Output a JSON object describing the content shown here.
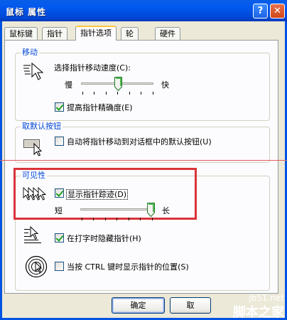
{
  "window": {
    "title": "鼠标 属性",
    "help_label": "?",
    "close_label": "✕"
  },
  "tabs": [
    {
      "label": "鼠标键"
    },
    {
      "label": "指针"
    },
    {
      "label": "指针选项",
      "active": true
    },
    {
      "label": "轮"
    },
    {
      "label": "硬件"
    }
  ],
  "motion": {
    "legend": "移动",
    "speed_label": "选择指针移动速度(C):",
    "slow_label": "慢",
    "fast_label": "快",
    "speed_value_fraction": 0.5,
    "precision_label": "提高指针精确度(E)",
    "precision_checked": true
  },
  "snap_to": {
    "legend": "取默认按钮",
    "snap_label": "自动将指针移动到对话框中的默认按钮(U)",
    "snap_checked": false
  },
  "visibility": {
    "legend": "可见性",
    "trails_label": "显示指针踪迹(D)",
    "trails_checked": true,
    "short_label": "短",
    "long_label": "长",
    "trail_length_fraction": 0.97,
    "hide_typing_label": "在打字时隐藏指针(H)",
    "hide_typing_checked": true,
    "ctrl_label": "当按 CTRL 键时显示指针的位置(S)",
    "ctrl_checked": false
  },
  "buttons": {
    "ok_label": "确定",
    "cancel_label": "取"
  },
  "watermark": {
    "line1": "jb51.net",
    "line2": "脚本之家"
  },
  "colors": {
    "title_bar": "#0054E3",
    "group_label": "#0046D5",
    "highlight_box": "#D9343A",
    "check_mark": "#21A121"
  }
}
